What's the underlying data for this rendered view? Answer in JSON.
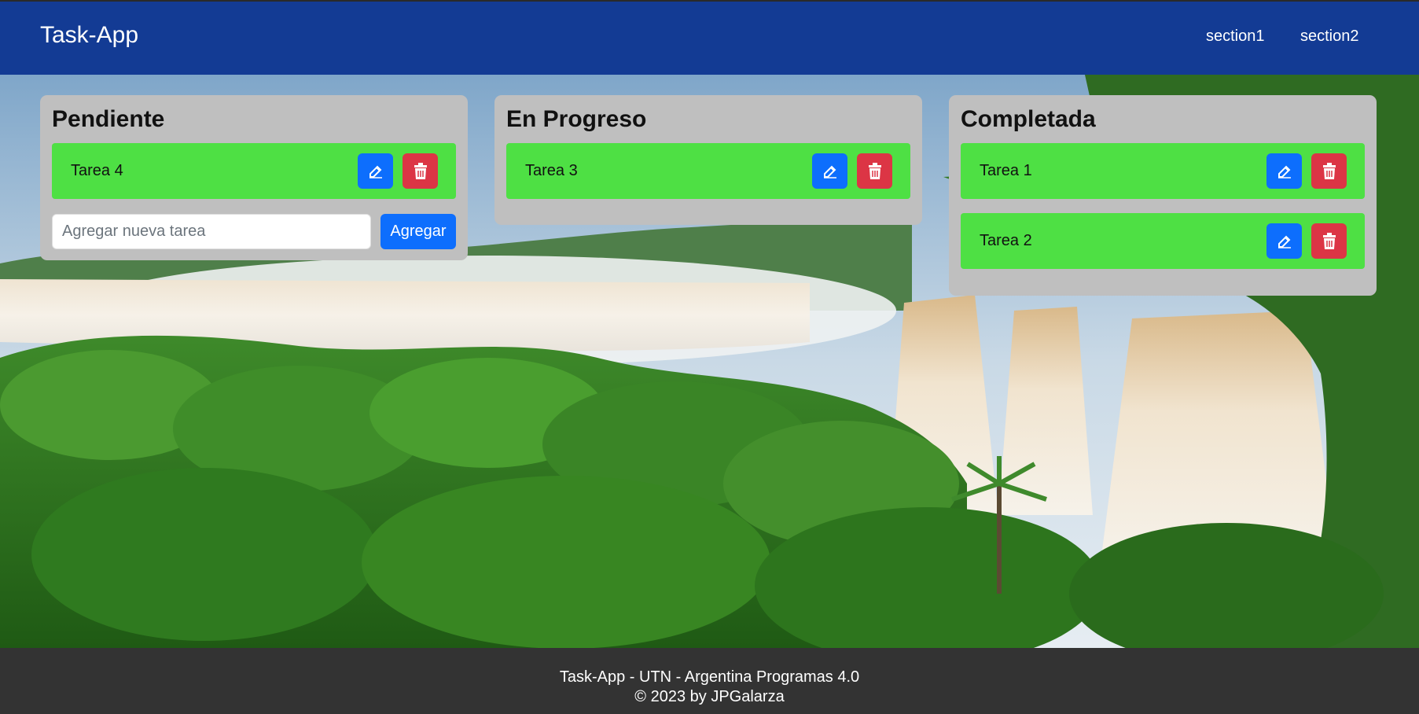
{
  "app": {
    "brand": "Task-App"
  },
  "nav": {
    "links": [
      "section1",
      "section2"
    ]
  },
  "columns": [
    {
      "title": "Pendiente",
      "tasks": [
        "Tarea 4"
      ],
      "add_form": {
        "placeholder": "Agregar nueva tarea",
        "button": "Agregar"
      }
    },
    {
      "title": "En Progreso",
      "tasks": [
        "Tarea 3"
      ]
    },
    {
      "title": "Completada",
      "tasks": [
        "Tarea 1",
        "Tarea 2"
      ]
    }
  ],
  "footer": {
    "line1": "Task-App - UTN - Argentina Programas 4.0",
    "line2": "© 2023 by JPGalarza"
  },
  "icons": {
    "edit": "edit-icon",
    "delete": "trash-icon"
  },
  "colors": {
    "navbar": "#133b94",
    "task_bg": "#4ee044",
    "column_bg": "#bfbfbf",
    "edit_button": "#0d6efd",
    "delete_button": "#dc3545",
    "footer": "#333333"
  }
}
